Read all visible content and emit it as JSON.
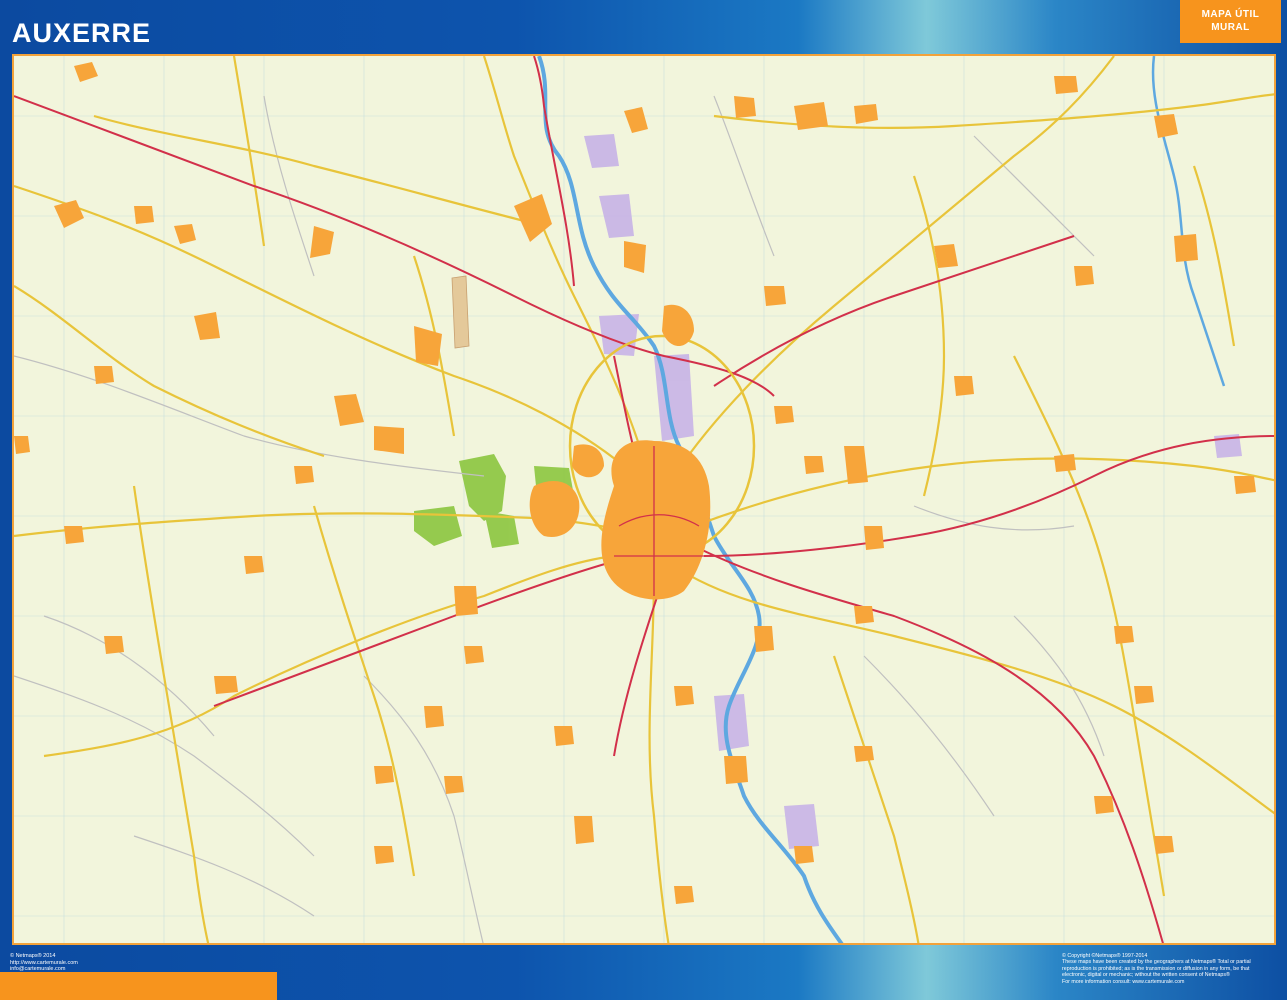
{
  "title": "AUXERRE",
  "badge": {
    "line1": "MAPA ÚTIL",
    "line2": "MURAL"
  },
  "footer_left": {
    "line1": "© Netmaps® 2014",
    "line2": "http://www.cartemurale.com",
    "line3": "info@cartemurale.com"
  },
  "footer_right": {
    "line1": "© Copyright ©Netmaps® 1997-2014",
    "line2": "These maps have been created by the geographers at Netmaps® Total or partial",
    "line3": "reproduction is prohibited; as is the transmission or diffusion in any form, be that",
    "line4": "electronic, digital or mechanic; without the written consent of Netmaps®",
    "line5": "For more information consult: www.cartemurale.com"
  },
  "colors": {
    "map_background": "#f2f5dc",
    "town": "#f7a53a",
    "highway": "#d2304a",
    "main_road": "#e8c43a",
    "river": "#5ea8e0",
    "forest": "#8cc63f",
    "industrial": "#c9b6e6",
    "badge": "#f7941d"
  }
}
